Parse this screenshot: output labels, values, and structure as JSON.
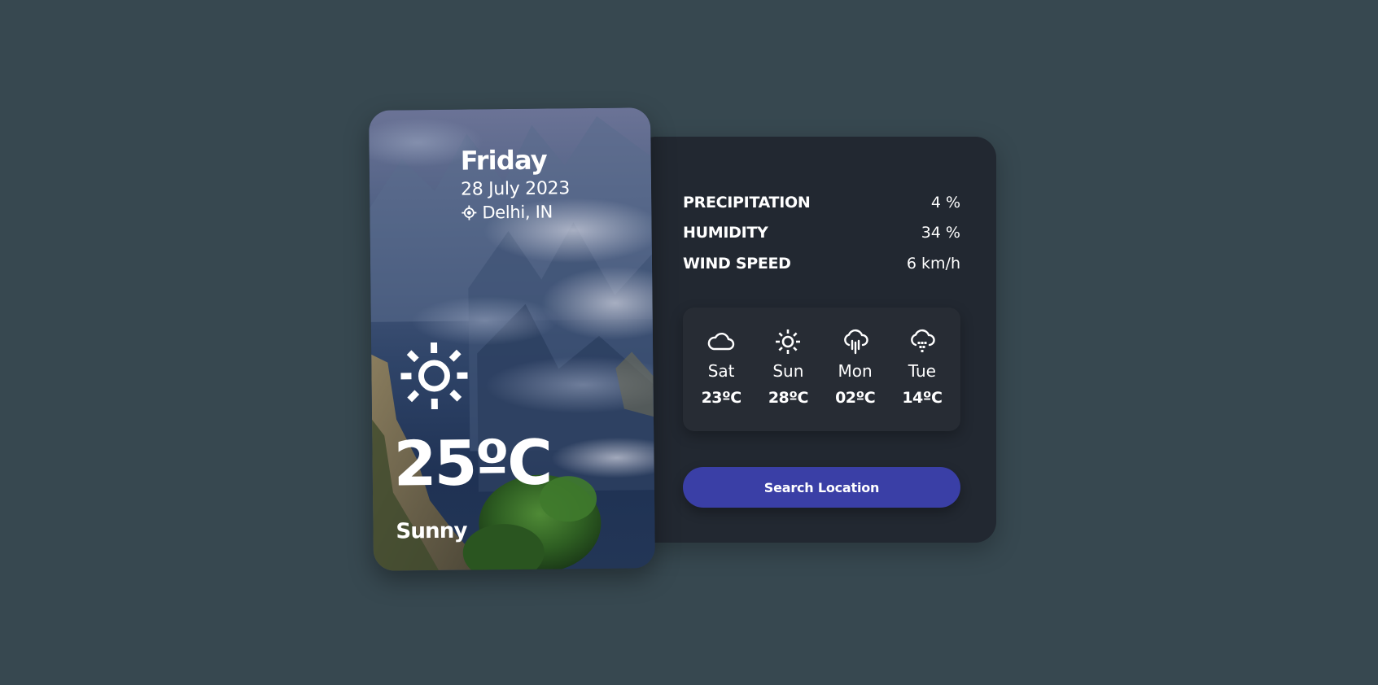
{
  "hero": {
    "day": "Friday",
    "date": "28 July 2023",
    "location": "Delhi, IN",
    "temperature": "25ºC",
    "description": "Sunny",
    "icon": "sun-icon"
  },
  "stats": [
    {
      "label": "PRECIPITATION",
      "value": "4 %"
    },
    {
      "label": "HUMIDITY",
      "value": "34 %"
    },
    {
      "label": "WIND SPEED",
      "value": "6 km/h"
    }
  ],
  "forecast": [
    {
      "day": "Sat",
      "temp": "23ºC",
      "icon": "cloud-icon"
    },
    {
      "day": "Sun",
      "temp": "28ºC",
      "icon": "sun-icon"
    },
    {
      "day": "Mon",
      "temp": "02ºC",
      "icon": "cloud-rain-icon"
    },
    {
      "day": "Tue",
      "temp": "14ºC",
      "icon": "cloud-hail-icon"
    }
  ],
  "search": {
    "label": "Search Location"
  },
  "colors": {
    "page_background": "#374850",
    "panel_background": "#222831",
    "button": "#3a3fa6",
    "text": "#ffffff"
  }
}
